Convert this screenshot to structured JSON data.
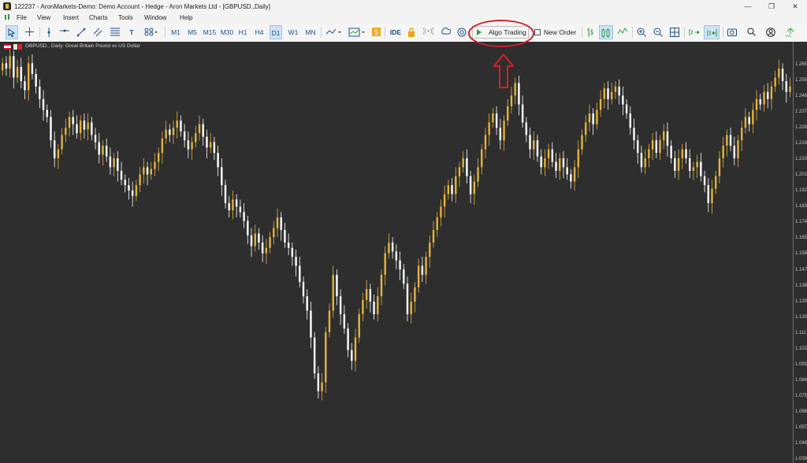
{
  "window": {
    "title": "122237 - AronMarkets-Demo: Demo Account - Hedge - Aron Markets Ltd - [GBPUSD.,Daily]",
    "controls": [
      "—",
      "❐",
      "✕"
    ]
  },
  "menu": {
    "items": [
      "File",
      "View",
      "Insert",
      "Charts",
      "Tools",
      "Window",
      "Help"
    ]
  },
  "toolbar": {
    "timeframes": [
      "M1",
      "M5",
      "M15",
      "M30",
      "H1",
      "H4",
      "D1",
      "W1",
      "MN"
    ],
    "active_timeframe": "D1",
    "ide_label": "IDE",
    "algo_trading_label": "Algo Trading",
    "new_order_label": "New Order",
    "icons": [
      "cursor-icon",
      "crosshair-icon",
      "vertical-line-icon",
      "horizontal-line-icon",
      "trend-line-icon",
      "channel-icon",
      "fibonacci-icon",
      "text-icon",
      "shapes-icon",
      "indicators-icon",
      "templates-icon",
      "expert-icon",
      "lock-icon",
      "signal-icon",
      "cloud-icon",
      "market-icon",
      "one-click-icon",
      "bar-chart-icon",
      "candles-icon",
      "line-chart-icon",
      "zoom-in-icon",
      "zoom-out-icon",
      "grid-icon",
      "autoscroll-icon",
      "chart-shift-icon",
      "screenshot-icon",
      "search-icon",
      "account-icon",
      "level-icon"
    ]
  },
  "chart": {
    "symbol_label": "GBPUSD., Daily:  Great Britain Pound vs US Dollar",
    "background": "#2e2e2e",
    "bull_color": "#e3b43d",
    "bear_color": "#ffffff"
  },
  "price_axis": {
    "ticks": [
      "1.265",
      "1.255",
      "1.246",
      "1.237",
      "1.228",
      "1.219",
      "1.210",
      "1.201",
      "1.192",
      "1.183",
      "1.174",
      "1.165",
      "1.156",
      "1.147",
      "1.138",
      "1.129",
      "1.120",
      "1.111",
      "1.102",
      "1.093",
      "1.084",
      "1.075",
      "1.066",
      "1.057",
      "1.048",
      "1.039"
    ]
  },
  "annotation": {
    "highlight_color": "#d0202a"
  },
  "chart_data": {
    "type": "candlestick",
    "symbol": "GBPUSD.",
    "timeframe": "Daily",
    "ylim": [
      1.035,
      1.27
    ],
    "closes": [
      1.258,
      1.255,
      1.262,
      1.25,
      1.256,
      1.248,
      1.243,
      1.258,
      1.252,
      1.245,
      1.238,
      1.232,
      1.228,
      1.215,
      1.205,
      1.21,
      1.218,
      1.222,
      1.228,
      1.224,
      1.219,
      1.226,
      1.221,
      1.225,
      1.218,
      1.214,
      1.207,
      1.212,
      1.206,
      1.2,
      1.205,
      1.198,
      1.193,
      1.19,
      1.187,
      1.184,
      1.19,
      1.196,
      1.2,
      1.196,
      1.199,
      1.203,
      1.208,
      1.216,
      1.221,
      1.218,
      1.222,
      1.226,
      1.22,
      1.215,
      1.21,
      1.214,
      1.219,
      1.224,
      1.217,
      1.211,
      1.214,
      1.208,
      1.2,
      1.19,
      1.18,
      1.176,
      1.182,
      1.178,
      1.175,
      1.17,
      1.162,
      1.156,
      1.163,
      1.158,
      1.152,
      1.155,
      1.161,
      1.166,
      1.172,
      1.165,
      1.158,
      1.155,
      1.15,
      1.145,
      1.136,
      1.128,
      1.12,
      1.105,
      1.085,
      1.075,
      1.08,
      1.108,
      1.12,
      1.14,
      1.128,
      1.118,
      1.11,
      1.098,
      1.092,
      1.105,
      1.118,
      1.126,
      1.132,
      1.125,
      1.118,
      1.128,
      1.14,
      1.152,
      1.158,
      1.153,
      1.148,
      1.143,
      1.135,
      1.118,
      1.125,
      1.133,
      1.145,
      1.14,
      1.15,
      1.158,
      1.165,
      1.172,
      1.178,
      1.185,
      1.19,
      1.185,
      1.195,
      1.2,
      1.205,
      1.195,
      1.185,
      1.192,
      1.2,
      1.21,
      1.218,
      1.225,
      1.23,
      1.222,
      1.215,
      1.226,
      1.234,
      1.24,
      1.247,
      1.235,
      1.225,
      1.218,
      1.21,
      1.215,
      1.206,
      1.2,
      1.205,
      1.21,
      1.203,
      1.198,
      1.205,
      1.2,
      1.196,
      1.192,
      1.2,
      1.21,
      1.218,
      1.225,
      1.23,
      1.224,
      1.232,
      1.238,
      1.244,
      1.238,
      1.242,
      1.245,
      1.24,
      1.235,
      1.23,
      1.222,
      1.215,
      1.208,
      1.2,
      1.205,
      1.21,
      1.215,
      1.208,
      1.215,
      1.22,
      1.212,
      1.205,
      1.198,
      1.205,
      1.21,
      1.205,
      1.198,
      1.2,
      1.203,
      1.195,
      1.19,
      1.18,
      1.188,
      1.195,
      1.205,
      1.212,
      1.218,
      1.212,
      1.205,
      1.215,
      1.222,
      1.228,
      1.224,
      1.232,
      1.238,
      1.235,
      1.242,
      1.238,
      1.245,
      1.25,
      1.255,
      1.248,
      1.242,
      1.245
    ],
    "bullish": [
      true,
      false,
      true,
      false,
      true,
      false,
      false,
      true,
      false,
      false,
      false,
      false,
      false,
      false,
      false,
      true,
      true,
      true,
      true,
      false,
      false,
      true,
      false,
      true,
      false,
      false,
      false,
      true,
      false,
      false,
      true,
      false,
      false,
      false,
      false,
      false,
      true,
      true,
      true,
      false,
      true,
      true,
      true,
      true,
      true,
      false,
      true,
      true,
      false,
      false,
      false,
      true,
      true,
      true,
      false,
      false,
      true,
      false,
      false,
      false,
      false,
      false,
      true,
      false,
      false,
      false,
      false,
      false,
      true,
      false,
      false,
      true,
      true,
      true,
      true,
      false,
      false,
      false,
      false,
      false,
      false,
      false,
      false,
      false,
      false,
      false,
      true,
      true,
      true,
      true,
      false,
      false,
      false,
      false,
      false,
      true,
      true,
      true,
      true,
      false,
      false,
      true,
      true,
      true,
      true,
      false,
      false,
      false,
      false,
      false,
      true,
      true,
      true,
      false,
      true,
      true,
      true,
      true,
      true,
      true,
      true,
      false,
      true,
      true,
      true,
      false,
      false,
      true,
      true,
      true,
      true,
      true,
      true,
      false,
      false,
      true,
      true,
      true,
      true,
      false,
      false,
      false,
      false,
      true,
      false,
      false,
      true,
      true,
      false,
      false,
      true,
      false,
      false,
      false,
      true,
      true,
      true,
      true,
      true,
      false,
      true,
      true,
      true,
      false,
      true,
      true,
      false,
      false,
      false,
      false,
      false,
      false,
      false,
      true,
      true,
      true,
      false,
      true,
      true,
      false,
      false,
      false,
      true,
      true,
      false,
      false,
      true,
      true,
      false,
      false,
      false,
      true,
      true,
      true,
      true,
      true,
      false,
      false,
      true,
      true,
      true,
      false,
      true,
      true,
      false,
      true,
      false,
      true,
      true,
      true,
      false,
      false,
      true
    ]
  }
}
